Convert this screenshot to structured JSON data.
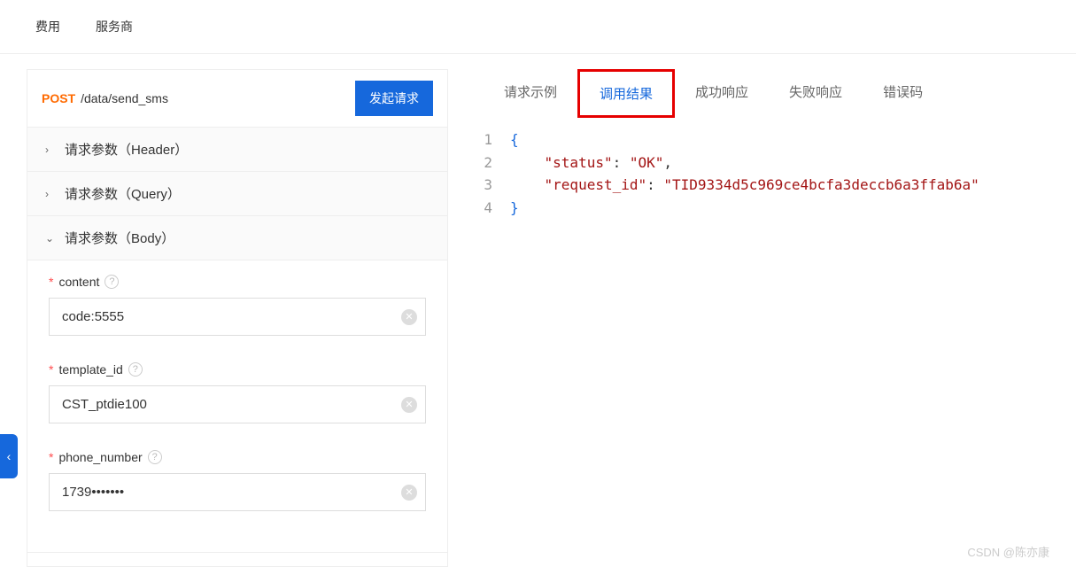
{
  "topnav": {
    "items": [
      "费用",
      "服务商"
    ]
  },
  "request": {
    "method": "POST",
    "path": "/data/send_sms",
    "send_button": "发起请求"
  },
  "accordion": {
    "header": "请求参数（Header）",
    "query": "请求参数（Query）",
    "body": "请求参数（Body）"
  },
  "body_fields": [
    {
      "key": "content",
      "label": "content",
      "value": "code:5555"
    },
    {
      "key": "template_id",
      "label": "template_id",
      "value": "CST_ptdie100"
    },
    {
      "key": "phone_number",
      "label": "phone_number",
      "value": "1739"
    }
  ],
  "tabs": {
    "items": [
      "请求示例",
      "调用结果",
      "成功响应",
      "失败响应",
      "错误码"
    ],
    "active_index": 1
  },
  "response": {
    "lines": [
      {
        "n": "1",
        "parts": [
          {
            "t": "brace",
            "v": "{"
          }
        ]
      },
      {
        "n": "2",
        "parts": [
          {
            "t": "pad",
            "v": "    "
          },
          {
            "t": "str",
            "v": "\"status\""
          },
          {
            "t": "punct",
            "v": ": "
          },
          {
            "t": "str",
            "v": "\"OK\""
          },
          {
            "t": "punct",
            "v": ","
          }
        ]
      },
      {
        "n": "3",
        "parts": [
          {
            "t": "pad",
            "v": "    "
          },
          {
            "t": "str",
            "v": "\"request_id\""
          },
          {
            "t": "punct",
            "v": ": "
          },
          {
            "t": "str",
            "v": "\"TID9334d5c969ce4bcfa3deccb6a3ffab6a\""
          }
        ]
      },
      {
        "n": "4",
        "parts": [
          {
            "t": "brace",
            "v": "}"
          }
        ]
      }
    ]
  },
  "watermark": "CSDN @陈亦康",
  "icons": {
    "help": "?",
    "clear": "✕",
    "chev_right": "›",
    "chev_down": "⌄",
    "handle": "‹"
  }
}
